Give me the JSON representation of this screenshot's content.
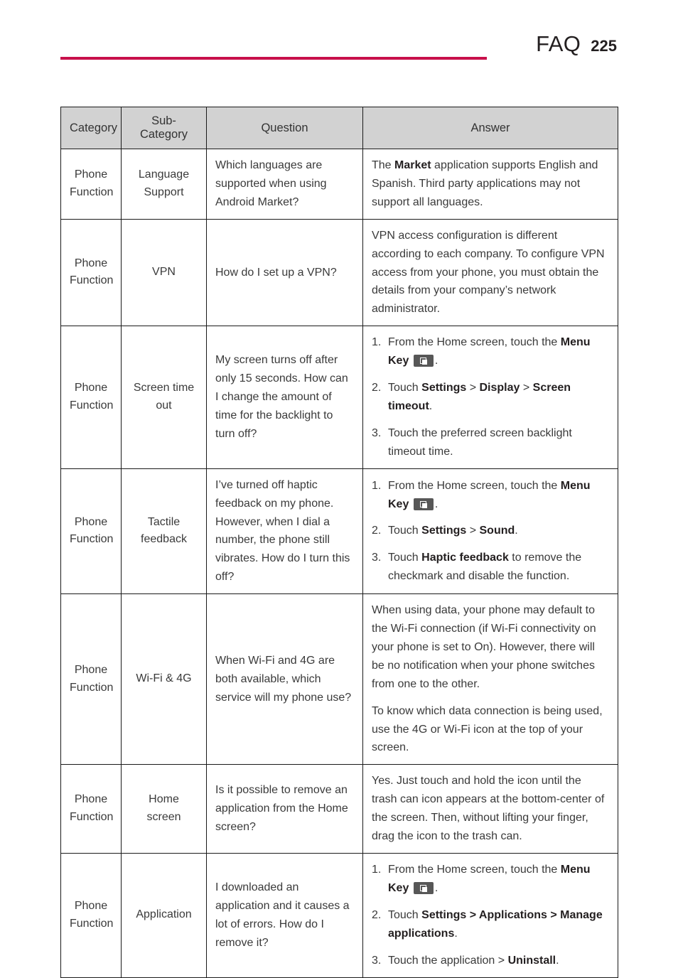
{
  "header": {
    "title": "FAQ",
    "page_number": "225",
    "rule_color": "#c8104b"
  },
  "table": {
    "columns": [
      "Category",
      "Sub-Category",
      "Question",
      "Answer"
    ],
    "header_bg": "#d2d2d2",
    "rows": [
      {
        "category": "Phone Function",
        "sub_category": "Language Support",
        "question": "Which languages are supported when using Android Market?",
        "answer_type": "paragraphs",
        "answer_paragraphs": [
          [
            {
              "t": "The ",
              "b": false
            },
            {
              "t": "Market",
              "b": true
            },
            {
              "t": " application supports English and Spanish. Third party applications may not support all languages.",
              "b": false
            }
          ]
        ]
      },
      {
        "category": "Phone Function",
        "sub_category": "VPN",
        "question": "How do I set up a VPN?",
        "answer_type": "paragraphs",
        "answer_paragraphs": [
          [
            {
              "t": "VPN access configuration is different according to each company. To configure VPN access from your phone, you must obtain the details from your company’s network administrator.",
              "b": false
            }
          ]
        ]
      },
      {
        "category": "Phone Function",
        "sub_category": "Screen time out",
        "question": "My screen turns off after only 15 seconds. How can I change the amount of time for the backlight to turn off?",
        "answer_type": "steps",
        "answer_steps": [
          {
            "num": "1.",
            "parts": [
              {
                "t": "From the Home screen, touch the ",
                "b": false
              },
              {
                "t": "Menu Key",
                "b": true
              },
              {
                "t": " ",
                "b": false
              },
              {
                "icon": "menu-key-icon"
              },
              {
                "t": ".",
                "b": false
              }
            ]
          },
          {
            "num": "2.",
            "parts": [
              {
                "t": "Touch ",
                "b": false
              },
              {
                "t": "Settings",
                "b": true
              },
              {
                "t": " > ",
                "b": false
              },
              {
                "t": "Display",
                "b": true
              },
              {
                "t": " > ",
                "b": false
              },
              {
                "t": "Screen timeout",
                "b": true
              },
              {
                "t": ".",
                "b": false
              }
            ]
          },
          {
            "num": "3.",
            "parts": [
              {
                "t": "Touch the preferred screen backlight timeout time.",
                "b": false
              }
            ]
          }
        ]
      },
      {
        "category": "Phone Function",
        "sub_category": "Tactile feedback",
        "question": "I’ve turned off haptic feedback on my phone. However, when I dial a number, the phone still vibrates. How do I turn this off?",
        "answer_type": "steps",
        "answer_steps": [
          {
            "num": "1.",
            "parts": [
              {
                "t": "From the Home screen, touch the ",
                "b": false
              },
              {
                "t": "Menu Key",
                "b": true
              },
              {
                "t": " ",
                "b": false
              },
              {
                "icon": "menu-key-icon"
              },
              {
                "t": ".",
                "b": false
              }
            ]
          },
          {
            "num": "2.",
            "parts": [
              {
                "t": "Touch ",
                "b": false
              },
              {
                "t": "Settings",
                "b": true
              },
              {
                "t": " > ",
                "b": false
              },
              {
                "t": "Sound",
                "b": true
              },
              {
                "t": ".",
                "b": false
              }
            ]
          },
          {
            "num": "3.",
            "parts": [
              {
                "t": "Touch ",
                "b": false
              },
              {
                "t": "Haptic feedback",
                "b": true
              },
              {
                "t": " to remove the checkmark and disable the function.",
                "b": false
              }
            ]
          }
        ]
      },
      {
        "category": "Phone Function",
        "sub_category": "Wi-Fi & 4G",
        "question": "When Wi-Fi and 4G are both available, which service will my phone use?",
        "answer_type": "paragraphs",
        "answer_paragraphs": [
          [
            {
              "t": "When using data, your phone may default to the Wi-Fi connection (if Wi-Fi connectivity on your phone is set to On). However, there will be no notification when your phone switches from one to the other.",
              "b": false
            }
          ],
          [
            {
              "t": "To know which data connection is being used, use the 4G or Wi-Fi icon at the top of your screen.",
              "b": false
            }
          ]
        ]
      },
      {
        "category": "Phone Function",
        "sub_category": "Home screen",
        "question": "Is it possible to remove an application from the Home screen?",
        "answer_type": "paragraphs",
        "answer_paragraphs": [
          [
            {
              "t": "Yes. Just touch and hold the icon until the trash can icon appears at the bottom-center of the screen. Then, without lifting your finger, drag the icon to the trash can.",
              "b": false
            }
          ]
        ]
      },
      {
        "category": "Phone Function",
        "sub_category": "Application",
        "question": "I downloaded an application and it causes a lot of errors. How do I remove it?",
        "answer_type": "steps",
        "answer_steps": [
          {
            "num": "1.",
            "parts": [
              {
                "t": "From the Home screen, touch the ",
                "b": false
              },
              {
                "t": "Menu Key",
                "b": true
              },
              {
                "t": " ",
                "b": false
              },
              {
                "icon": "menu-key-icon"
              },
              {
                "t": ".",
                "b": false
              }
            ]
          },
          {
            "num": "2.",
            "parts": [
              {
                "t": "Touch ",
                "b": false
              },
              {
                "t": "Settings > Applications > Manage applications",
                "b": true
              },
              {
                "t": ".",
                "b": false
              }
            ]
          },
          {
            "num": "3.",
            "parts": [
              {
                "t": "Touch the application > ",
                "b": false
              },
              {
                "t": "Uninstall",
                "b": true
              },
              {
                "t": ".",
                "b": false
              }
            ]
          }
        ]
      }
    ]
  }
}
